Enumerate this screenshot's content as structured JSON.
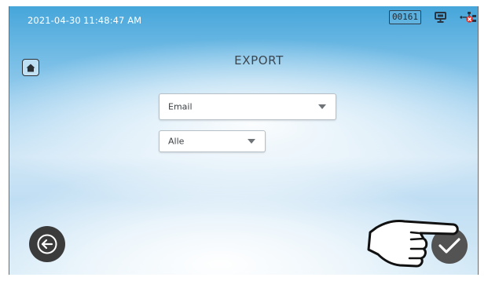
{
  "status_bar": {
    "date": "2021-04-30",
    "time": "11:48:47 AM",
    "counter": "00161",
    "icons": [
      "screen-icon",
      "network-disconnected-icon"
    ]
  },
  "header": {
    "title": "EXPORT",
    "home_icon": "home-icon"
  },
  "form": {
    "destination": {
      "value": "Email",
      "options_visible": [
        "Email"
      ]
    },
    "scope": {
      "value": "Alle",
      "options_visible": [
        "Alle"
      ]
    }
  },
  "footer": {
    "back_icon": "arrow-left-icon",
    "confirm_icon": "checkmark-icon",
    "pointer_icon": "hand-pointer-icon"
  },
  "colors": {
    "background_top": "#46a6da",
    "background_bottom": "#d5eaf7",
    "button_dark": "#3b3b3b",
    "confirm_button": "#535353",
    "status_text": "#ffffff",
    "network_error": "#e0322b"
  }
}
